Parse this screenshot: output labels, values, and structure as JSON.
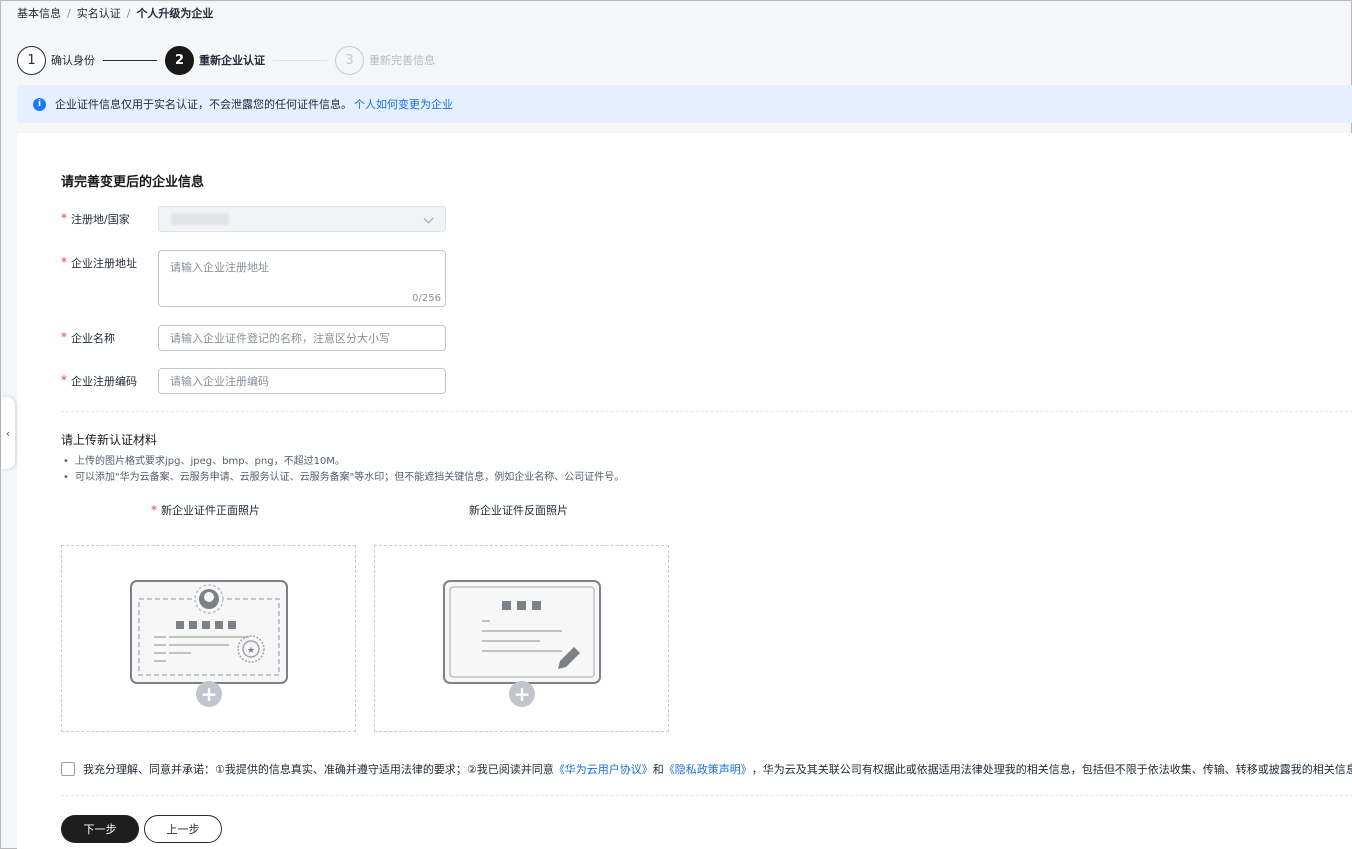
{
  "breadcrumb": {
    "items": [
      "基本信息",
      "实名认证"
    ],
    "current": "个人升级为企业"
  },
  "steps": [
    {
      "num": "1",
      "label": "确认身份",
      "state": "done"
    },
    {
      "num": "2",
      "label": "重新企业认证",
      "state": "active"
    },
    {
      "num": "3",
      "label": "重新完善信息",
      "state": "todo"
    }
  ],
  "notice": {
    "text": "企业证件信息仅用于实名认证，不会泄露您的任何证件信息。",
    "link": "个人如何变更为企业"
  },
  "form": {
    "title": "请完善变更后的企业信息",
    "country_label": "注册地/国家",
    "address_label": "企业注册地址",
    "address_placeholder": "请输入企业注册地址",
    "address_counter": "0/256",
    "name_label": "企业名称",
    "name_placeholder": "请输入企业证件登记的名称，注意区分大小写",
    "code_label": "企业注册编码",
    "code_placeholder": "请输入企业注册编码"
  },
  "upload": {
    "title": "请上传新认证材料",
    "tip1": "上传的图片格式要求jpg、jpeg、bmp、png，不超过10M。",
    "tip2": "可以添加\"华为云备案、云服务申请、云服务认证、云服务备案\"等水印；但不能遮挡关键信息，例如企业名称、公司证件号。",
    "front_label": "新企业证件正面照片",
    "back_label": "新企业证件反面照片",
    "plus": "+"
  },
  "agreement": {
    "text1": "我充分理解、同意并承诺：①我提供的信息真实、准确并遵守适用法律的要求；②我已阅读并同意",
    "link1": "《华为云用户协议》",
    "and": "和",
    "link2": "《隐私政策声明》",
    "text2": "，华为云及其关联公司有权据此或依据适用法律处理我的相关信息，包括但不限于依法收集、传输、转移或披露我的相关信息。"
  },
  "buttons": {
    "next": "下一步",
    "prev": "上一步"
  },
  "colors": {
    "accent_link": "#1a6fd9",
    "required": "#e54545",
    "notice_bg": "#e4efff",
    "primary_button": "#1e1e1e"
  }
}
